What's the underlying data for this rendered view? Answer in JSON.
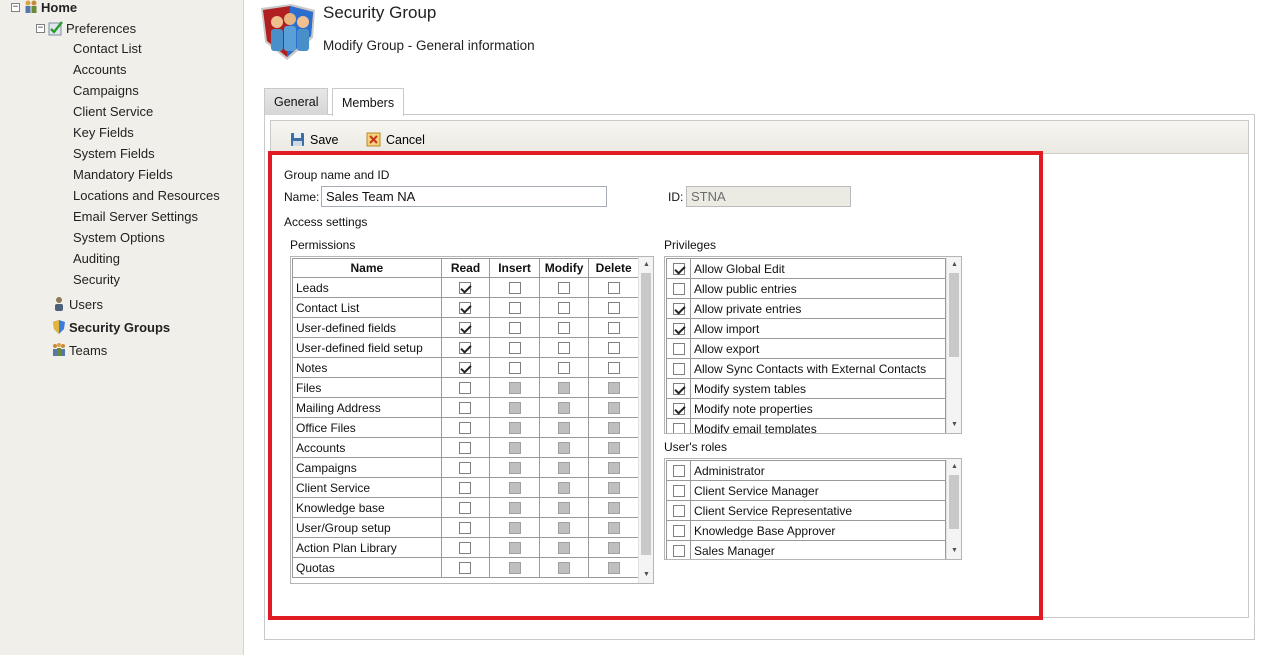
{
  "sidebar": {
    "home": "Home",
    "preferences": "Preferences",
    "items": [
      "Contact List",
      "Accounts",
      "Campaigns",
      "Client Service",
      "Key Fields",
      "System Fields",
      "Mandatory Fields",
      "Locations and Resources",
      "Email Server Settings",
      "System Options",
      "Auditing",
      "Security"
    ],
    "users": "Users",
    "security_groups": "Security Groups",
    "teams": "Teams"
  },
  "header": {
    "title": "Security Group",
    "subtitle": "Modify Group - General information"
  },
  "tabs": [
    {
      "label": "General"
    },
    {
      "label": "Members"
    }
  ],
  "toolbar": {
    "save_label": "Save",
    "cancel_label": "Cancel"
  },
  "form": {
    "group_section": "Group name and ID",
    "name_label": "Name:",
    "name_value": "Sales Team NA",
    "id_label": "ID:",
    "id_value": "STNA",
    "access_section": "Access settings",
    "permissions_label": "Permissions",
    "privileges_label": "Privileges",
    "roles_label": "User's roles"
  },
  "permissions": {
    "headers": [
      "Name",
      "Read",
      "Insert",
      "Modify",
      "Delete"
    ],
    "rows": [
      {
        "name": "Leads",
        "read": true,
        "insert": false,
        "modify": false,
        "delete": false,
        "enabled": true
      },
      {
        "name": "Contact List",
        "read": true,
        "insert": false,
        "modify": false,
        "delete": false,
        "enabled": true
      },
      {
        "name": "User-defined fields",
        "read": true,
        "insert": false,
        "modify": false,
        "delete": false,
        "enabled": true
      },
      {
        "name": "User-defined field setup",
        "read": true,
        "insert": false,
        "modify": false,
        "delete": false,
        "enabled": true
      },
      {
        "name": "Notes",
        "read": true,
        "insert": false,
        "modify": false,
        "delete": false,
        "enabled": true
      },
      {
        "name": "Files",
        "read": false,
        "enabled": false
      },
      {
        "name": "Mailing Address",
        "read": false,
        "enabled": false
      },
      {
        "name": "Office Files",
        "read": false,
        "enabled": false
      },
      {
        "name": "Accounts",
        "read": false,
        "enabled": false
      },
      {
        "name": "Campaigns",
        "read": false,
        "enabled": false
      },
      {
        "name": "Client Service",
        "read": false,
        "enabled": false
      },
      {
        "name": "Knowledge base",
        "read": false,
        "enabled": false
      },
      {
        "name": "User/Group setup",
        "read": false,
        "enabled": false
      },
      {
        "name": "Action Plan Library",
        "read": false,
        "enabled": false
      },
      {
        "name": "Quotas",
        "read": false,
        "enabled": false
      }
    ]
  },
  "privileges": [
    {
      "label": "Allow Global Edit",
      "checked": true
    },
    {
      "label": "Allow public entries",
      "checked": false
    },
    {
      "label": "Allow private entries",
      "checked": true
    },
    {
      "label": "Allow import",
      "checked": true
    },
    {
      "label": "Allow export",
      "checked": false
    },
    {
      "label": "Allow Sync Contacts with External Contacts",
      "checked": false
    },
    {
      "label": "Modify system tables",
      "checked": true
    },
    {
      "label": "Modify note properties",
      "checked": true
    },
    {
      "label": "Modify email templates",
      "checked": false
    }
  ],
  "roles": [
    {
      "label": "Administrator",
      "checked": false
    },
    {
      "label": "Client Service Manager",
      "checked": false
    },
    {
      "label": "Client Service Representative",
      "checked": false
    },
    {
      "label": "Knowledge Base Approver",
      "checked": false
    },
    {
      "label": "Sales Manager",
      "checked": false
    }
  ],
  "colors": {
    "highlight": "#e01b24",
    "sidebar_bg": "#f1efe9"
  }
}
